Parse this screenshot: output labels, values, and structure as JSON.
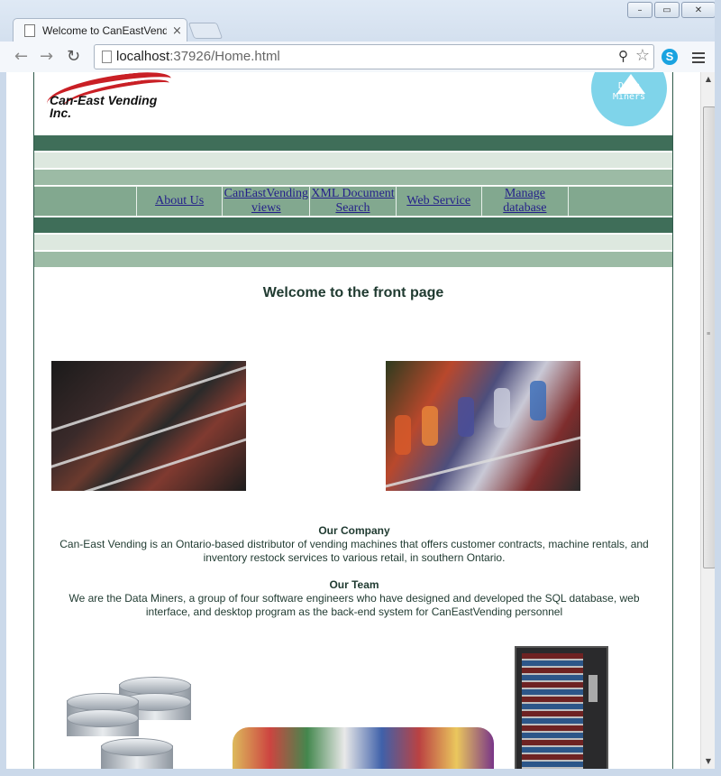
{
  "browser": {
    "tab_title": "Welcome to CanEastVend",
    "url_host": "localhost",
    "url_rest": ":37926/Home.html",
    "window_controls": [
      "–",
      "▭",
      "✕"
    ]
  },
  "header": {
    "company_logo_text": "Can-East Vending Inc.",
    "team_logo_line1": "Data",
    "team_logo_line2": "Miners"
  },
  "nav": {
    "items": [
      {
        "label": "About Us"
      },
      {
        "label": "CanEastVending views"
      },
      {
        "label": "XML Document Search"
      },
      {
        "label": "Web Service"
      },
      {
        "label": "Manage database"
      }
    ]
  },
  "main": {
    "welcome": "Welcome to the front page",
    "company_heading": "Our Company",
    "company_text": "Can-East Vending is an Ontario-based distributor of vending machines that offers customer contracts, machine rentals, and inventory restock services to various retail, in southern Ontario.",
    "team_heading": "Our Team",
    "team_text": "We are the Data Miners, a group of four software engineers who have designed and developed the SQL database, web interface, and desktop program as the back-end system for CanEastVending personnel"
  },
  "colors": {
    "dark_band": "#3f6e59",
    "nav_band": "#82a88f",
    "link": "#241f8a"
  }
}
